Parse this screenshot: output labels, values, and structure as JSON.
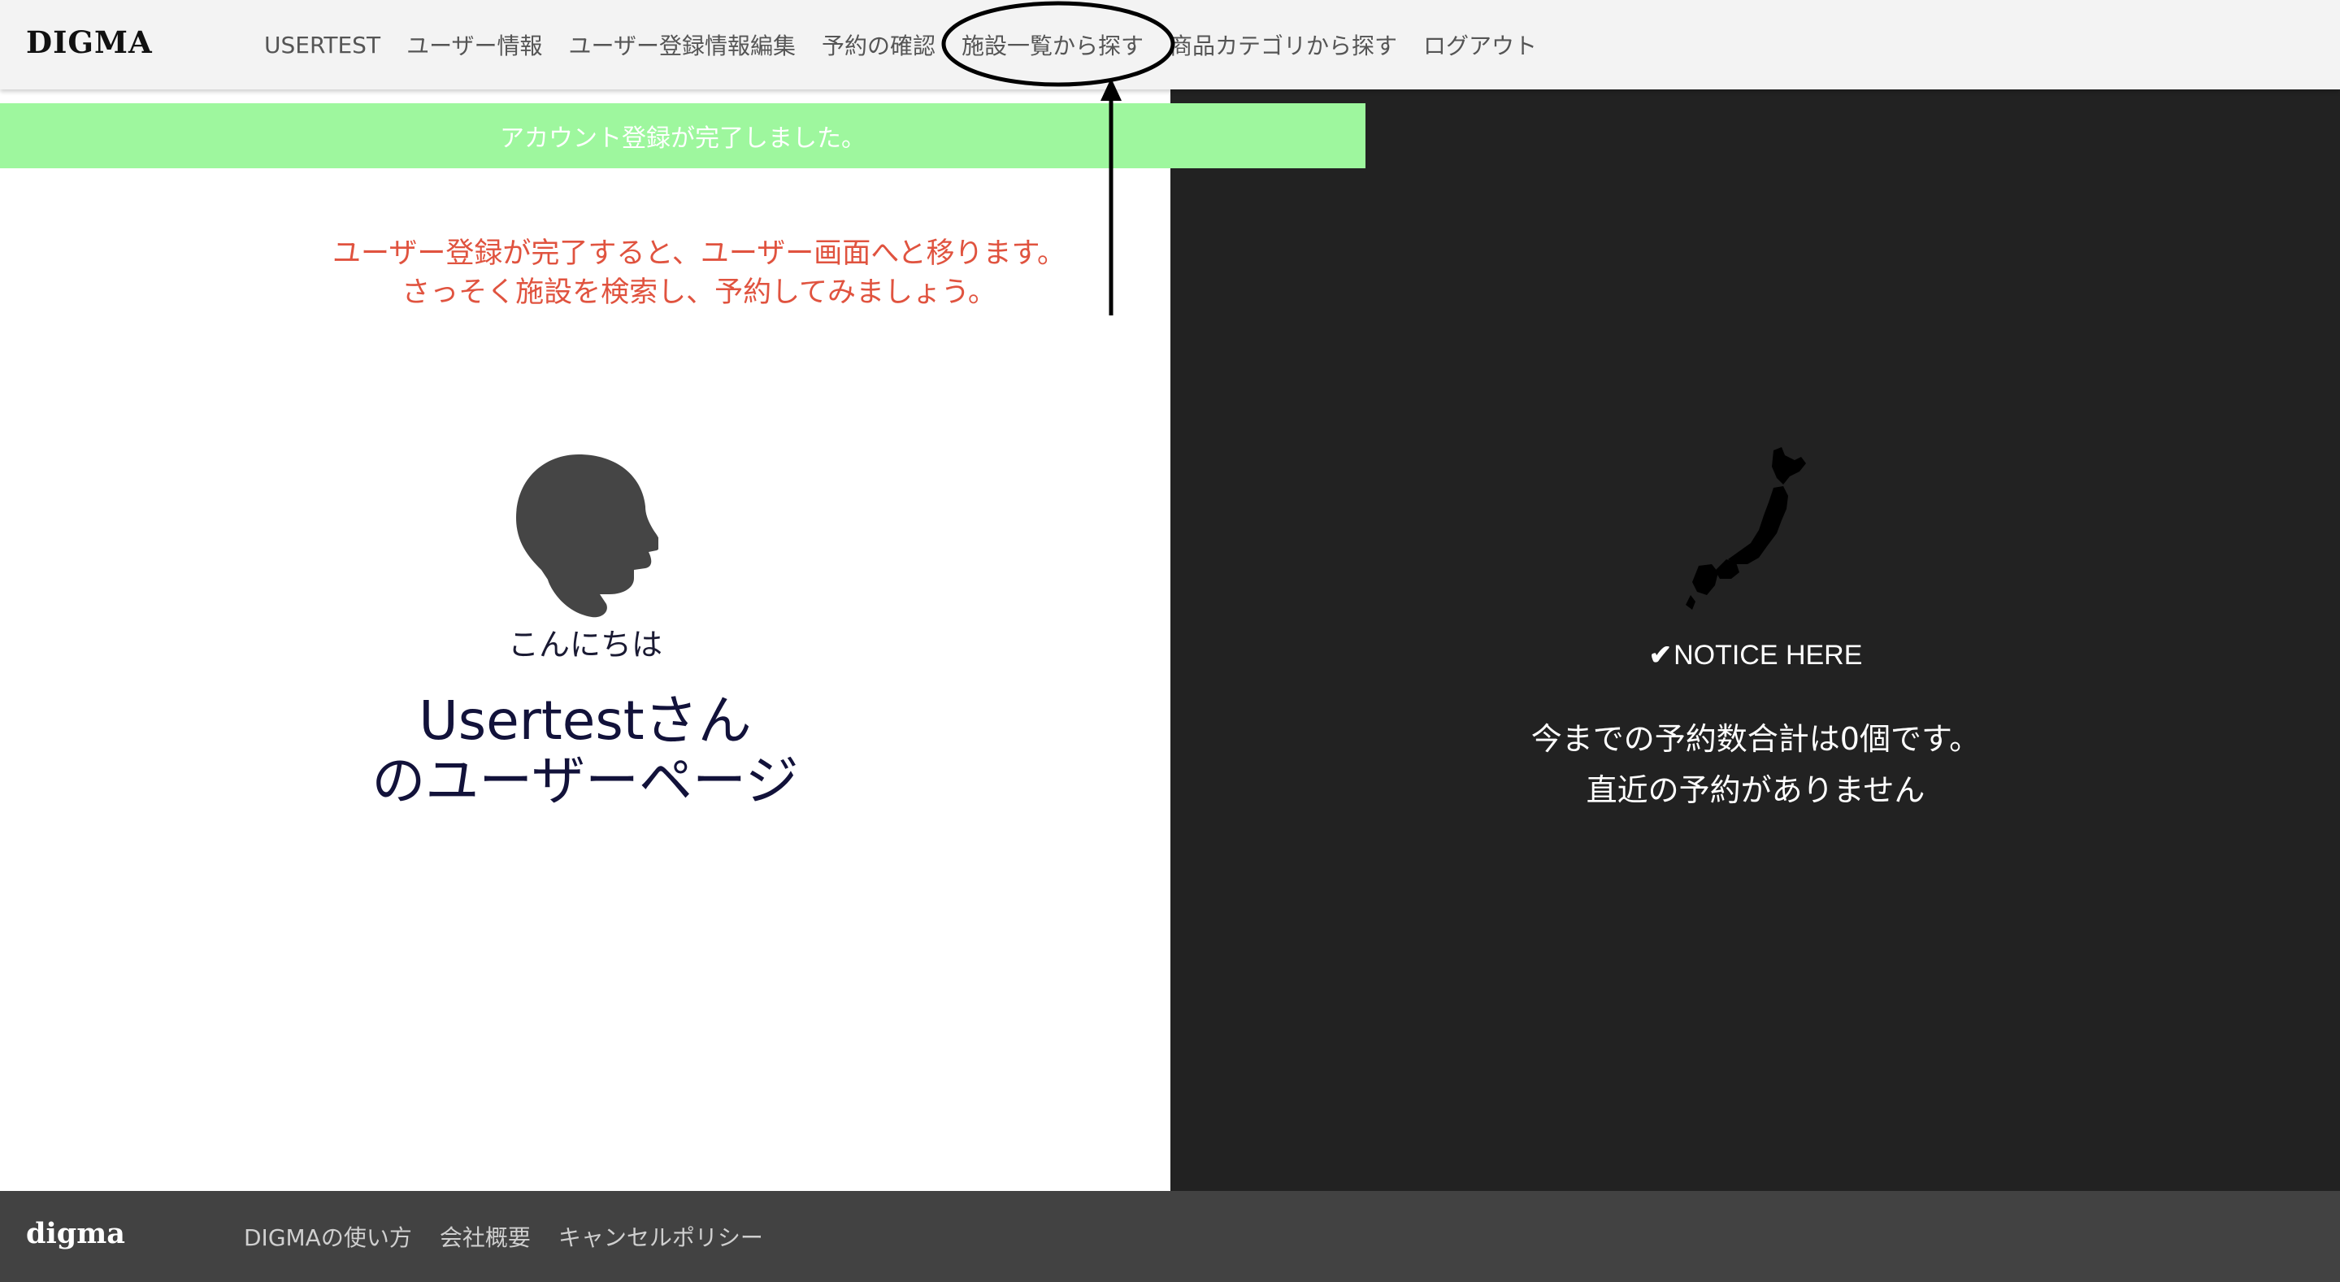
{
  "header": {
    "logo": "DIGMA",
    "nav": [
      {
        "label": "USERTEST"
      },
      {
        "label": "ユーザー情報"
      },
      {
        "label": "ユーザー登録情報編集"
      },
      {
        "label": "予約の確認"
      },
      {
        "label": "施設一覧から探す"
      },
      {
        "label": "商品カテゴリから探す"
      },
      {
        "label": "ログアウト"
      }
    ]
  },
  "flash": {
    "message": "アカウント登録が完了しました。",
    "color": "#9ef79e"
  },
  "annotation": {
    "line1": "ユーザー登録が完了すると、ユーザー画面へと移ります。",
    "line2": "さっそく施設を検索し、予約してみましょう。",
    "color": "#e0533f"
  },
  "user_panel": {
    "icon": "head-icon",
    "greeting": "こんにちは",
    "title_line1": "Usertestさん",
    "title_line2": "のユーザーページ"
  },
  "notice_panel": {
    "icon": "japan-map-icon",
    "notice_label": "NOTICE HERE",
    "stats_line1": "今までの予約数合計は0個です。",
    "stats_line2": "直近の予約がありません"
  },
  "footer": {
    "logo": "digma",
    "links": [
      {
        "label": "DIGMAの使い方"
      },
      {
        "label": "会社概要"
      },
      {
        "label": "キャンセルポリシー"
      }
    ]
  }
}
